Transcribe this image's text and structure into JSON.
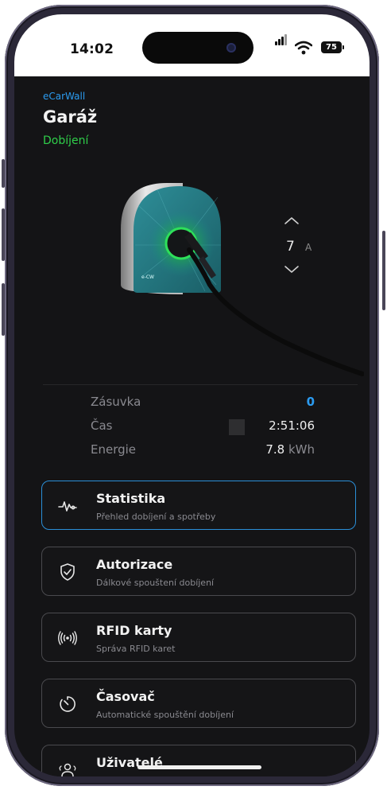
{
  "status_bar": {
    "time": "14:02",
    "battery": "75"
  },
  "header": {
    "brand": "eCarWall",
    "title": "Garáž",
    "state": "Dobíjení"
  },
  "charger": {
    "logo_text": "e-CW"
  },
  "current_control": {
    "value": "7",
    "unit": "A"
  },
  "stats": [
    {
      "label": "Zásuvka",
      "value": "0",
      "unit": ""
    },
    {
      "label": "Čas",
      "value": "2:51:06",
      "unit": ""
    },
    {
      "label": "Energie",
      "value": "7.8",
      "unit": "kWh"
    }
  ],
  "menu": [
    {
      "title": "Statistika",
      "subtitle": "Přehled dobíjení a spotřeby",
      "icon": "activity-pulse-icon",
      "active": true
    },
    {
      "title": "Autorizace",
      "subtitle": "Dálkové spouštení dobíjení",
      "icon": "shield-check-icon",
      "active": false
    },
    {
      "title": "RFID karty",
      "subtitle": "Správa RFID karet",
      "icon": "rfid-signal-icon",
      "active": false
    },
    {
      "title": "Časovač",
      "subtitle": "Automatické spouštění dobíjení",
      "icon": "timer-icon",
      "active": false
    },
    {
      "title": "Uživatelé",
      "subtitle": "",
      "icon": "users-icon",
      "active": false
    }
  ],
  "colors": {
    "accent_blue": "#2b9bf0",
    "charging_green": "#2fcf4a",
    "background": "#141416"
  }
}
